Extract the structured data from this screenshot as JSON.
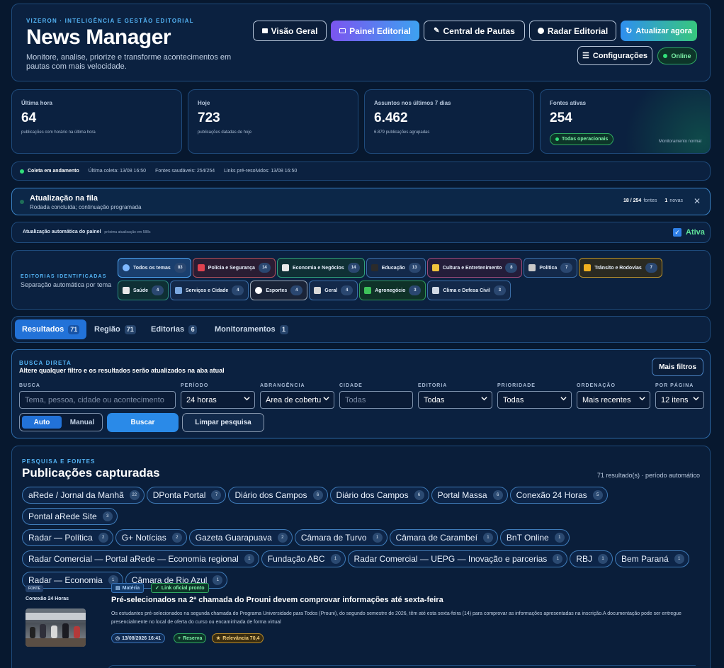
{
  "header": {
    "eyebrow": "VIZERON · INTELIGÊNCIA E GESTÃO EDITORIAL",
    "title": "News Manager",
    "subtitle": "Monitore, analise, priorize e transforme acontecimentos em pautas com mais velocidade.",
    "nav": {
      "overview": "Visão Geral",
      "editorial": "Painel Editorial",
      "pautas": "Central de Pautas",
      "radar": "Radar Editorial",
      "refresh": "Atualizar agora",
      "settings": "Configurações",
      "online": "Online"
    }
  },
  "stats": [
    {
      "label": "Última hora",
      "value": "64",
      "sub": "publicações com horário na última hora"
    },
    {
      "label": "Hoje",
      "value": "723",
      "sub": "publicações datadas de hoje"
    },
    {
      "label": "Assuntos nos últimos 7 dias",
      "value": "6.462",
      "sub": "6.879 publicações agrupadas"
    },
    {
      "label": "Fontes ativas",
      "value": "254",
      "badge": "Todas operacionais",
      "note": "Monitoramento normal"
    }
  ],
  "status_bar": {
    "collecting": "Coleta em andamento",
    "last": "Última coleta: 13/08 16:50",
    "healthy": "Fontes saudáveis: 254/254",
    "links": "Links pré-resolvidos: 13/08 16:50"
  },
  "queue": {
    "title": "Atualização na fila",
    "subtitle": "Rodada concluída; continuação programada",
    "progress": "18 / 254",
    "progress_unit": "fontes",
    "new_count": "1",
    "new_label": "novas"
  },
  "auto_update": {
    "label": "Atualização automática do painel",
    "next": "próxima atualização em 588s",
    "state": "Ativa"
  },
  "editorias": {
    "title": "EDITORIAS IDENTIFICADAS",
    "subtitle": "Separação automática por tema",
    "chips": [
      {
        "label": "Todos os temas",
        "count": "83",
        "icon": "circle-icon",
        "color": "#7fb8ff"
      },
      {
        "label": "Polícia e Segurança",
        "count": "14",
        "icon": "siren-icon",
        "color": "#e0424f"
      },
      {
        "label": "Economia e Negócios",
        "count": "14",
        "icon": "chart-icon",
        "color": "#e8e8e8"
      },
      {
        "label": "Educação",
        "count": "13",
        "icon": "graduation-cap-icon",
        "color": "#2b2b2b"
      },
      {
        "label": "Cultura e Entretenimento",
        "count": "8",
        "icon": "masks-icon",
        "color": "#f0c33c"
      },
      {
        "label": "Política",
        "count": "7",
        "icon": "government-icon",
        "color": "#c9c9c9"
      },
      {
        "label": "Trânsito e Rodovias",
        "count": "7",
        "icon": "barrier-icon",
        "color": "#f0b020"
      },
      {
        "label": "Saúde",
        "count": "4",
        "icon": "hospital-icon",
        "color": "#e8e8e8"
      },
      {
        "label": "Serviços e Cidade",
        "count": "4",
        "icon": "city-icon",
        "color": "#7aa8e0"
      },
      {
        "label": "Esportes",
        "count": "4",
        "icon": "soccer-ball-icon",
        "color": "#ffffff"
      },
      {
        "label": "Geral",
        "count": "4",
        "icon": "newspaper-icon",
        "color": "#d8d8d8"
      },
      {
        "label": "Agronegócio",
        "count": "3",
        "icon": "plant-icon",
        "color": "#3ec25a"
      },
      {
        "label": "Clima e Defesa Civil",
        "count": "3",
        "icon": "cloud-icon",
        "color": "#d0d8e4"
      }
    ]
  },
  "tabs": [
    {
      "label": "Resultados",
      "count": "71"
    },
    {
      "label": "Região",
      "count": "71"
    },
    {
      "label": "Editorias",
      "count": "6"
    },
    {
      "label": "Monitoramentos",
      "count": "1"
    }
  ],
  "search": {
    "eyebrow": "BUSCA DIRETA",
    "title": "Altere qualquer filtro e os resultados serão atualizados na aba atual",
    "more_filters": "Mais filtros",
    "labels": {
      "query": "BUSCA",
      "period": "PERÍODO",
      "scope": "ABRANGÊNCIA",
      "city": "CIDADE",
      "editoria": "EDITORIA",
      "priority": "PRIORIDADE",
      "order": "ORDENAÇÃO",
      "per_page": "POR PÁGINA"
    },
    "query_placeholder": "Tema, pessoa, cidade ou acontecimento",
    "period": "24 horas",
    "scope": "Área de cobertura",
    "city_placeholder": "Todas",
    "editoria": "Todas",
    "priority": "Todas",
    "order": "Mais recentes",
    "per_page": "12 itens",
    "mode_auto": "Auto",
    "mode_manual": "Manual",
    "search_btn": "Buscar",
    "clear_btn": "Limpar pesquisa"
  },
  "results": {
    "eyebrow": "PESQUISA E FONTES",
    "title": "Publicações capturadas",
    "meta": "71 resultado(s) · período automático",
    "sources": [
      {
        "name": "aRede / Jornal da Manhã",
        "count": "22"
      },
      {
        "name": "DPonta Portal",
        "count": "7"
      },
      {
        "name": "Diário dos Campos",
        "count": "6"
      },
      {
        "name": "Diário dos Campos",
        "count": "6"
      },
      {
        "name": "Portal Massa",
        "count": "6"
      },
      {
        "name": "Conexão 24 Horas",
        "count": "5"
      },
      {
        "name": "Pontal aRede Site",
        "count": "3"
      },
      {
        "name": "Radar — Política",
        "count": "2"
      },
      {
        "name": "G+ Notícias",
        "count": "2"
      },
      {
        "name": "Gazeta Guarapuava",
        "count": "2"
      },
      {
        "name": "Câmara de Turvo",
        "count": "1"
      },
      {
        "name": "Câmara de Carambeí",
        "count": "1"
      },
      {
        "name": "BnT Online",
        "count": "1"
      },
      {
        "name": "Radar Comercial — Portal aRede — Economia regional",
        "count": "1"
      },
      {
        "name": "Fundação ABC",
        "count": "1"
      },
      {
        "name": "Radar Comercial — UEPG — Inovação e parcerias",
        "count": "1"
      },
      {
        "name": "RBJ",
        "count": "1"
      },
      {
        "name": "Bem Paraná",
        "count": "1"
      },
      {
        "name": "Radar — Economia",
        "count": "1"
      },
      {
        "name": "Câmara de Rio Azul",
        "count": "1"
      }
    ]
  },
  "article": {
    "source_tag": "FONTE",
    "source": "Conexão 24 Horas",
    "badge_type": "Matéria",
    "badge_link": "Link oficial pronto",
    "title": "Pré-selecionados na 2ª chamada do Prouni devem comprovar informações até sexta-feira",
    "body": "Os estudantes pré-selecionados na segunda chamada do Programa Universidade para Todos (Prouni), do segundo semestre de 2026, têm até esta sexta-feira (14) para comprovar as informações apresentadas na inscrição.A documentação pode ser entregue presencialmente no local de oferta do curso ou encaminhada de forma virtual",
    "date": "13/08/2026 16:41",
    "reserve": "Reserva",
    "relevance": "Relevância 70,4"
  }
}
